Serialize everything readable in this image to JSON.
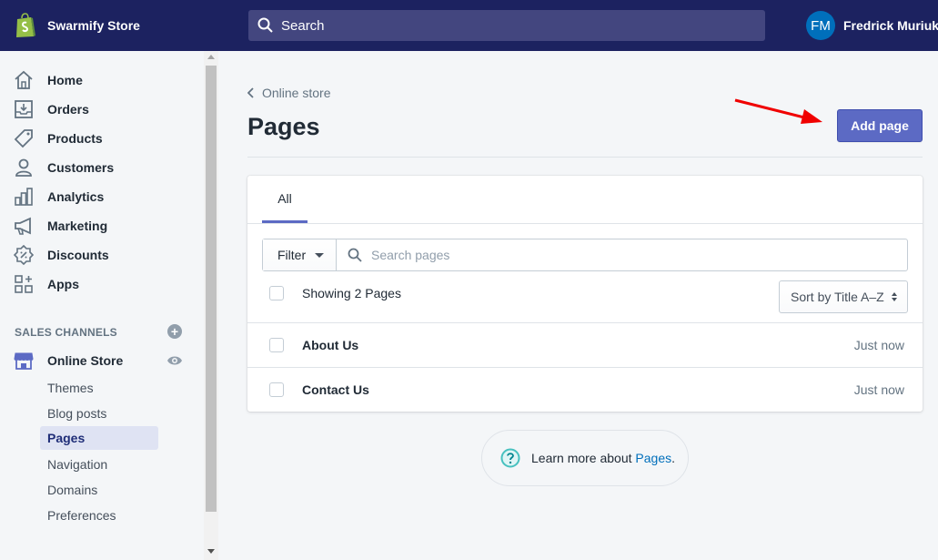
{
  "topbar": {
    "store_name": "Swarmify Store",
    "search_placeholder": "Search",
    "user_initials": "FM",
    "user_name": "Fredrick Muriuki"
  },
  "sidebar": {
    "items": [
      {
        "label": "Home",
        "icon": "home-icon"
      },
      {
        "label": "Orders",
        "icon": "orders-icon"
      },
      {
        "label": "Products",
        "icon": "tag-icon"
      },
      {
        "label": "Customers",
        "icon": "person-icon"
      },
      {
        "label": "Analytics",
        "icon": "bar-chart-icon"
      },
      {
        "label": "Marketing",
        "icon": "megaphone-icon"
      },
      {
        "label": "Discounts",
        "icon": "discount-icon"
      },
      {
        "label": "Apps",
        "icon": "apps-icon"
      }
    ],
    "sales_channels_title": "SALES CHANNELS",
    "online_store": "Online Store",
    "sub_items": [
      "Themes",
      "Blog posts",
      "Pages",
      "Navigation",
      "Domains",
      "Preferences"
    ],
    "active_sub_item": "Pages"
  },
  "main": {
    "breadcrumb": "Online store",
    "title": "Pages",
    "add_button": "Add page",
    "tabs": [
      "All"
    ],
    "filter_label": "Filter",
    "search_placeholder": "Search pages",
    "showing_text": "Showing 2 Pages",
    "sort_label": "Sort by Title A–Z",
    "rows": [
      {
        "title": "About Us",
        "time": "Just now"
      },
      {
        "title": "Contact Us",
        "time": "Just now"
      }
    ],
    "learn_prefix": "Learn more about ",
    "learn_link": "Pages",
    "learn_suffix": "."
  },
  "colors": {
    "topbar": "#1c2260",
    "accent": "#5c6ac4",
    "annotation_arrow": "#f00000"
  }
}
